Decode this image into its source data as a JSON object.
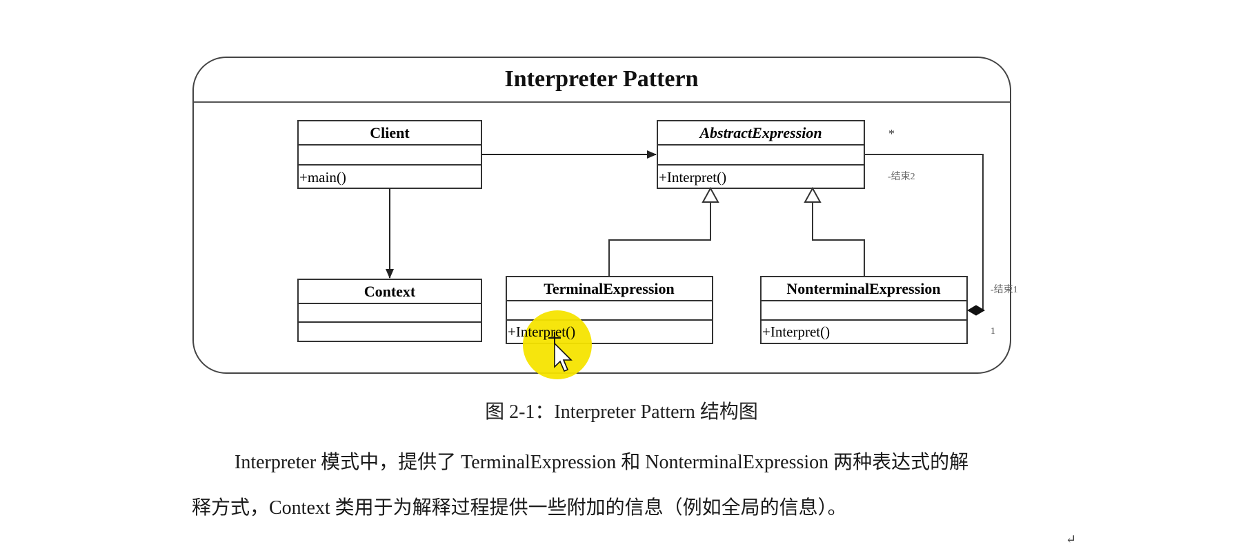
{
  "figure": {
    "title": "Interpreter Pattern",
    "classes": {
      "client": {
        "name": "Client",
        "method": "+main()"
      },
      "abstract_expression": {
        "name": "AbstractExpression",
        "method": "+Interpret()"
      },
      "context": {
        "name": "Context",
        "method": ""
      },
      "terminal_expression": {
        "name": "TerminalExpression",
        "method": "+Interpret()"
      },
      "nonterminal_expression": {
        "name": "NonterminalExpression",
        "method": "+Interpret()"
      }
    },
    "annotations": {
      "star": "*",
      "constraint2": "-结束2",
      "constraint1": "-结束1",
      "one": "1"
    }
  },
  "caption": "图 2-1：Interpreter Pattern 结构图",
  "paragraph": {
    "line1": "Interpreter 模式中，提供了 TerminalExpression 和 NonterminalExpression 两种表达式的解",
    "line2": "释方式，Context 类用于为解释过程提供一些附加的信息（例如全局的信息）。"
  },
  "return_mark": "↵",
  "colors": {
    "highlight": "#f5e400",
    "stroke": "#333333"
  }
}
